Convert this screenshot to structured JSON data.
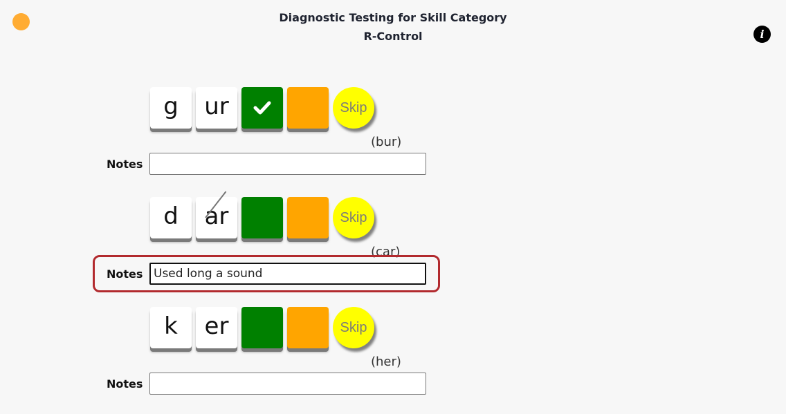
{
  "header": {
    "title": "Diagnostic Testing for Skill Category",
    "subtitle": "R-Control"
  },
  "status_indicator": {
    "color": "#ffac33",
    "icon": "status-dot"
  },
  "info_button": {
    "icon": "info-icon",
    "glyph": "i"
  },
  "notes_label": "Notes",
  "skip_label": "Skip",
  "items": [
    {
      "tiles": [
        "g",
        "ur"
      ],
      "struck_tiles": [],
      "marked_correct": true,
      "word_hint": "(bur)",
      "notes_value": "",
      "notes_focused": false
    },
    {
      "tiles": [
        "d",
        "ar"
      ],
      "struck_tiles": [
        1
      ],
      "marked_correct": false,
      "word_hint": "(car)",
      "notes_value": "Used long a sound",
      "notes_focused": true
    },
    {
      "tiles": [
        "k",
        "er"
      ],
      "struck_tiles": [],
      "marked_correct": false,
      "word_hint": "(her)",
      "notes_value": "",
      "notes_focused": false
    }
  ],
  "colors": {
    "correct": "#008000",
    "incorrect": "#ffa500",
    "skip": "#ffff00",
    "highlight": "#b22a2e"
  }
}
